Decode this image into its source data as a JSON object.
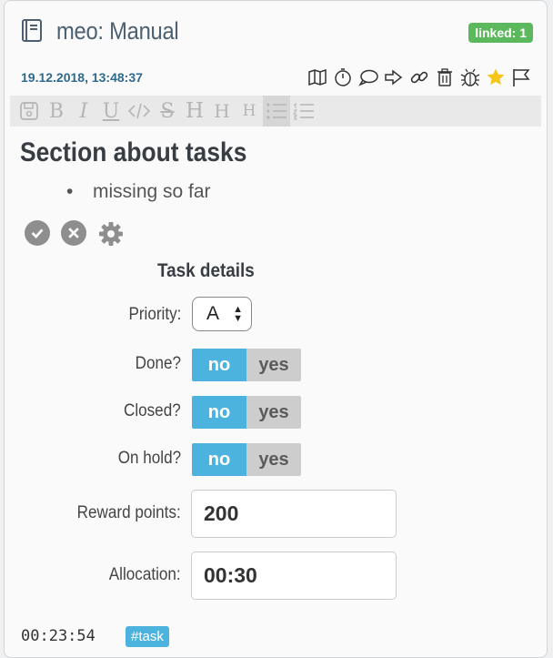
{
  "header": {
    "title": "meo: Manual",
    "linked_badge": "linked: 1",
    "date": "19.12.2018, 13:48:37",
    "actions": [
      "map-icon",
      "stopwatch-icon",
      "comment-icon",
      "share-icon",
      "link-icon",
      "trash-icon",
      "bug-icon",
      "star-icon",
      "flag-icon"
    ]
  },
  "toolbar": {
    "bold": "B",
    "italic": "I",
    "underline": "U",
    "strike": "S",
    "h1": "H",
    "h2": "H",
    "h3": "H"
  },
  "content": {
    "section_title": "Section about tasks",
    "bullets": [
      "missing so far"
    ]
  },
  "task": {
    "heading": "Task details",
    "priority_label": "Priority:",
    "priority_value": "A",
    "done_label": "Done?",
    "closed_label": "Closed?",
    "onhold_label": "On hold?",
    "no_label": "no",
    "yes_label": "yes",
    "reward_label": "Reward points:",
    "reward_value": "200",
    "allocation_label": "Allocation:",
    "allocation_value": "00:30"
  },
  "footer": {
    "timer": "00:23:54",
    "tag": "#task"
  },
  "colors": {
    "accent": "#4cb3df",
    "linked": "#5cb85c",
    "date": "#2e6a8c",
    "star": "#f5c518"
  }
}
